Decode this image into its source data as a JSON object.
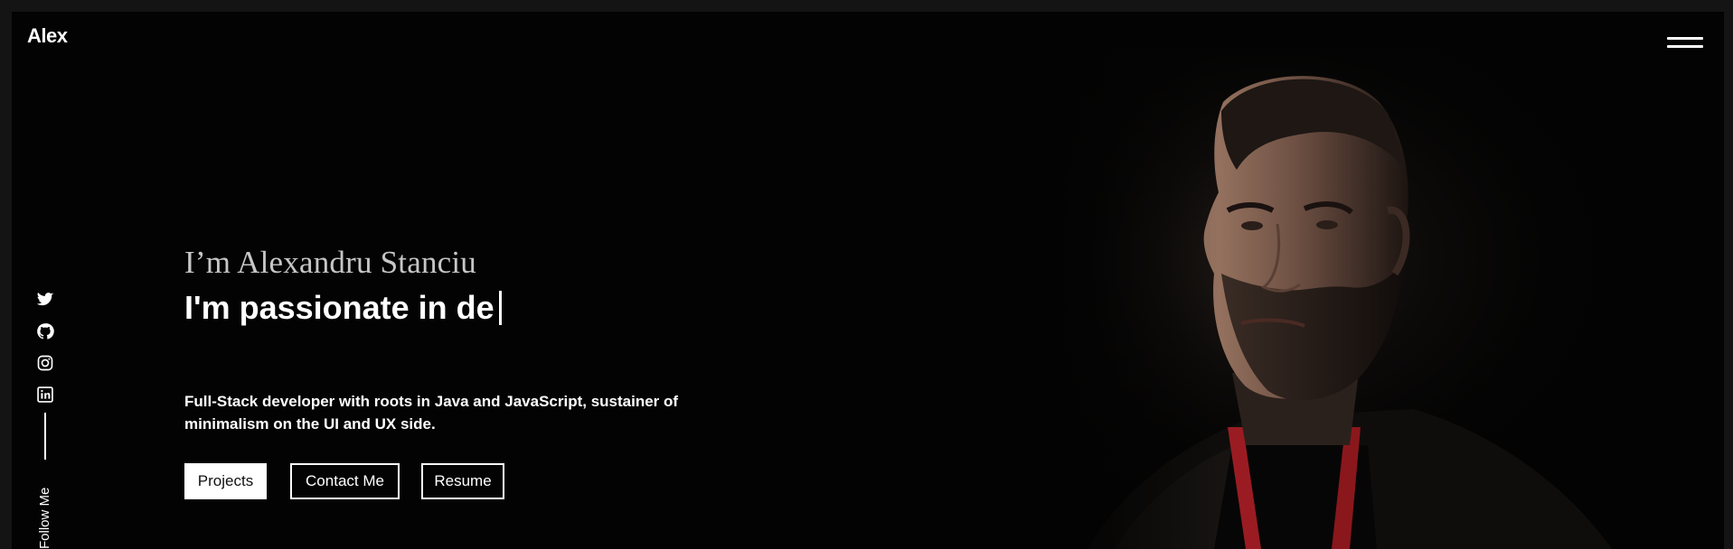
{
  "header": {
    "logo": "Alex",
    "menu_icon": "hamburger-menu-icon"
  },
  "hero": {
    "intro": "I’m Alexandru Stanciu",
    "headline": "I'm passionate in de",
    "description": "Full-Stack developer with roots in Java and JavaScript, sustainer of minimalism on the UI and UX side.",
    "buttons": {
      "projects": "Projects",
      "contact": "Contact Me",
      "resume": "Resume"
    }
  },
  "social": {
    "icons": [
      "twitter-icon",
      "github-icon",
      "instagram-icon",
      "linkedin-icon"
    ],
    "follow_label": "Follow Me"
  },
  "colors": {
    "background": "#030303",
    "outer_frame": "#141414",
    "text": "#ffffff",
    "intro_text": "#c6c6c6",
    "lanyard": "#9a1c22"
  }
}
